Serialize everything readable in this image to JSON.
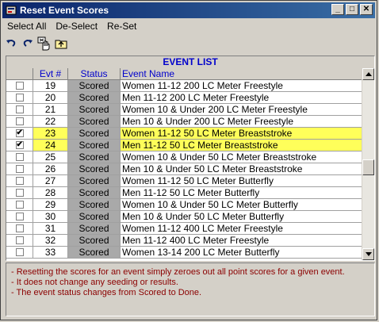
{
  "window": {
    "title": "Reset Event Scores",
    "minimize": "_",
    "maximize": "□",
    "close": "✕"
  },
  "menu": {
    "items": [
      "Select All",
      "De-Select",
      "Re-Set"
    ]
  },
  "toolbar": {
    "icons": [
      "undo-icon",
      "redo-icon",
      "reset-hand-icon",
      "up-folder-icon"
    ]
  },
  "list": {
    "caption": "EVENT LIST",
    "columns": [
      "",
      "Evt #",
      "Status",
      "Event Name"
    ],
    "rows": [
      {
        "checked": false,
        "evt": "19",
        "status": "Scored",
        "name": "Women 11-12 200 LC Meter Freestyle"
      },
      {
        "checked": false,
        "evt": "20",
        "status": "Scored",
        "name": "Men 11-12 200 LC Meter Freestyle"
      },
      {
        "checked": false,
        "evt": "21",
        "status": "Scored",
        "name": "Women 10 & Under 200 LC Meter Freestyle"
      },
      {
        "checked": false,
        "evt": "22",
        "status": "Scored",
        "name": "Men 10 & Under 200 LC Meter Freestyle"
      },
      {
        "checked": true,
        "evt": "23",
        "status": "Scored",
        "name": "Women 11-12 50 LC Meter Breaststroke"
      },
      {
        "checked": true,
        "evt": "24",
        "status": "Scored",
        "name": "Men 11-12 50 LC Meter Breaststroke"
      },
      {
        "checked": false,
        "evt": "25",
        "status": "Scored",
        "name": "Women 10 & Under 50 LC Meter Breaststroke"
      },
      {
        "checked": false,
        "evt": "26",
        "status": "Scored",
        "name": "Men 10 & Under 50 LC Meter Breaststroke"
      },
      {
        "checked": false,
        "evt": "27",
        "status": "Scored",
        "name": "Women 11-12 50 LC Meter Butterfly"
      },
      {
        "checked": false,
        "evt": "28",
        "status": "Scored",
        "name": "Men 11-12 50 LC Meter Butterfly"
      },
      {
        "checked": false,
        "evt": "29",
        "status": "Scored",
        "name": "Women 10 & Under 50 LC Meter Butterfly"
      },
      {
        "checked": false,
        "evt": "30",
        "status": "Scored",
        "name": "Men 10 & Under 50 LC Meter Butterfly"
      },
      {
        "checked": false,
        "evt": "31",
        "status": "Scored",
        "name": "Women 11-12 400 LC Meter Freestyle"
      },
      {
        "checked": false,
        "evt": "32",
        "status": "Scored",
        "name": "Men 11-12 400 LC Meter Freestyle"
      },
      {
        "checked": false,
        "evt": "33",
        "status": "Scored",
        "name": "Women 13-14 200 LC Meter Butterfly"
      }
    ]
  },
  "notes": [
    "- Resetting the scores for an event simply zeroes out all point scores for a given event.",
    "- It does not change any seeding or results.",
    "- The event status changes from Scored to Done."
  ],
  "colors": {
    "titlebar": "#0a246a",
    "selected_row": "#ffff5a",
    "status_cell": "#a9a9a9",
    "note_text": "#8b0000",
    "header_text": "#0000cc"
  }
}
